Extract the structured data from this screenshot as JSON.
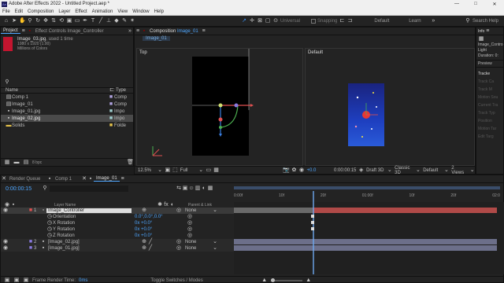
{
  "window": {
    "title": "Adobe After Effects 2022 - Untitled Project.aep *",
    "controls": [
      "—",
      "□",
      "✕"
    ]
  },
  "menu": [
    "File",
    "Edit",
    "Composition",
    "Layer",
    "Effect",
    "Animation",
    "View",
    "Window",
    "Help"
  ],
  "toolbar": {
    "universal": "Universal",
    "snapping": "Snapping",
    "workspaces": [
      "Default",
      "Learn"
    ],
    "search_placeholder": "Search Help"
  },
  "project": {
    "tabs": [
      "Project",
      "Effect Controls Image_Controller"
    ],
    "selected_name": "Image_03.jpg",
    "selected_used": ", used 1 time",
    "selected_dims": "1080 x 1920 (1.00)",
    "selected_colors": "Millions of Colors",
    "col_name": "Name",
    "col_type": "Type",
    "items": [
      {
        "name": "Comp 1",
        "type": "Comp"
      },
      {
        "name": "Image_01",
        "type": "Comp"
      },
      {
        "name": "Image_01.jpg",
        "type": "Impo"
      },
      {
        "name": "Image_02.jpg",
        "type": "Impo"
      },
      {
        "name": "Solids",
        "type": "Folde"
      }
    ],
    "bpc": "8 bpc"
  },
  "composition": {
    "tab": "Composition",
    "tab_name": "Image_01",
    "subtab": "Image_01",
    "top_label": "Top",
    "default_label": "Default",
    "zoom": "12.5%",
    "resolution": "Full",
    "offset": "+0.0",
    "timecode": "0:00:00:15",
    "renderer": "Draft 3D",
    "view3d": "Classic 3D",
    "camera": "Default",
    "views": "2 Views"
  },
  "info": {
    "tab": "Info",
    "name": "Image_Contro",
    "light": "Light",
    "duration": "Duration: 0:",
    "preview": "Preview",
    "tracker": "Tracke",
    "side": [
      "Track Ca",
      "Track M",
      "Motion Sou",
      "Current Tra",
      "Track Typ",
      "Position",
      "Motion Tar",
      "Edit Targ"
    ]
  },
  "timeline": {
    "tabs": [
      "Render Queue",
      "Comp 1",
      "Image_01"
    ],
    "timecode": "0:00:00:15",
    "layer_name_col": "Layer Name",
    "parent_col": "Parent & Link",
    "layers": [
      {
        "num": "1",
        "name": "Image_Controller",
        "parent": "None"
      },
      {
        "num": "2",
        "name": "[Image_02.jpg]",
        "parent": "None"
      },
      {
        "num": "3",
        "name": "[Image_01.jpg]",
        "parent": "None"
      }
    ],
    "props": [
      {
        "name": "Orientation",
        "value": "0.0°,0.0°,0.0°"
      },
      {
        "name": "X Rotation",
        "value": "0x +0.0°"
      },
      {
        "name": "Y Rotation",
        "value": "0x +0.0°"
      },
      {
        "name": "Z Rotation",
        "value": "0x +0.0°"
      }
    ],
    "ruler": [
      "0:00f",
      "10f",
      "20f",
      "01:00f",
      "10f",
      "20f",
      "02:0"
    ],
    "frame_render_label": "Frame Render Time:",
    "frame_render_value": "0ms",
    "toggle_label": "Toggle Switches / Modes"
  }
}
